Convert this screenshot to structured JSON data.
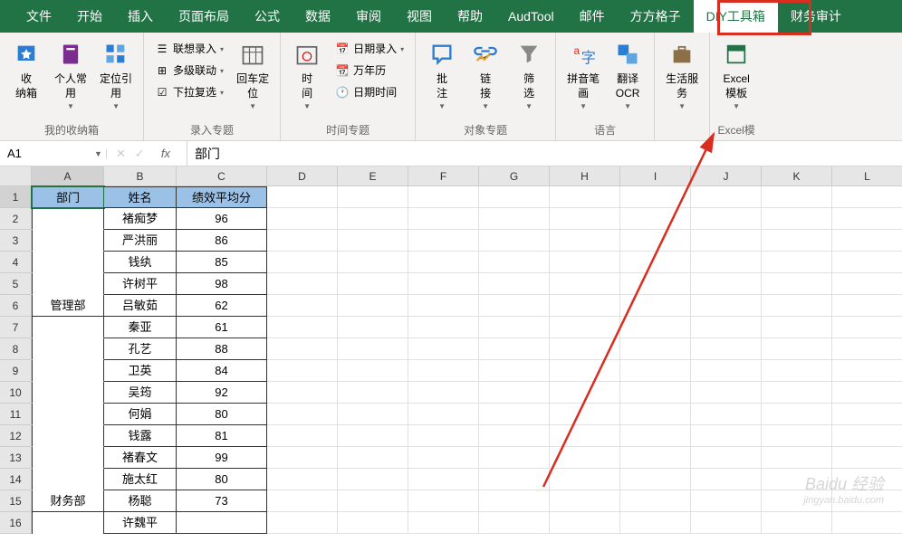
{
  "tabs": [
    "文件",
    "开始",
    "插入",
    "页面布局",
    "公式",
    "数据",
    "审阅",
    "视图",
    "帮助",
    "AudTool",
    "邮件",
    "方方格子",
    "DIY工具箱",
    "财务审计"
  ],
  "active_tab_index": 12,
  "ribbon_groups": {
    "collect": {
      "label": "我的收纳箱",
      "items": [
        {
          "label": "收\n纳箱"
        },
        {
          "label": "个人常\n用",
          "arrow": true
        },
        {
          "label": "定位引\n用",
          "arrow": true
        }
      ]
    },
    "input": {
      "label": "录入专题",
      "items": [
        {
          "label": "联想录入",
          "arrow": true
        },
        {
          "label": "多级联动",
          "arrow": true
        },
        {
          "label": "下拉复选",
          "arrow": true
        }
      ],
      "big_item": {
        "label": "回车定\n位",
        "arrow": true
      }
    },
    "time": {
      "label": "时间专题",
      "big_item": {
        "label": "时\n间",
        "arrow": true
      },
      "items": [
        {
          "label": "日期录入",
          "arrow": true
        },
        {
          "label": "万年历"
        },
        {
          "label": "日期时间"
        }
      ]
    },
    "object": {
      "label": "对象专题",
      "items": [
        {
          "label": "批\n注",
          "arrow": true
        },
        {
          "label": "链\n接",
          "arrow": true
        },
        {
          "label": "筛\n选",
          "arrow": true
        }
      ]
    },
    "lang": {
      "label": "语言",
      "items": [
        {
          "label": "拼音笔\n画",
          "arrow": true
        },
        {
          "label": "翻译\nOCR",
          "arrow": true
        }
      ]
    },
    "life": {
      "label": "",
      "items": [
        {
          "label": "生活服\n务",
          "arrow": true
        }
      ]
    },
    "excel": {
      "label": "Excel模",
      "items": [
        {
          "label": "Excel\n模板",
          "arrow": true
        }
      ]
    }
  },
  "name_box": "A1",
  "formula_value": "部门",
  "columns": [
    "A",
    "B",
    "C",
    "D",
    "E",
    "F",
    "G",
    "H",
    "I",
    "J",
    "K",
    "L"
  ],
  "sheet": {
    "headers": [
      "部门",
      "姓名",
      "绩效平均分"
    ],
    "rows": [
      {
        "dept": "",
        "name": "褚痴梦",
        "score": "96"
      },
      {
        "dept": "",
        "name": "严洪丽",
        "score": "86"
      },
      {
        "dept": "",
        "name": "钱纨",
        "score": "85"
      },
      {
        "dept": "",
        "name": "许树平",
        "score": "98"
      },
      {
        "dept": "管理部",
        "name": "吕敏茹",
        "score": "62"
      },
      {
        "dept": "",
        "name": "秦亚",
        "score": "61"
      },
      {
        "dept": "",
        "name": "孔艺",
        "score": "88"
      },
      {
        "dept": "",
        "name": "卫英",
        "score": "84"
      },
      {
        "dept": "",
        "name": "吴筠",
        "score": "92"
      },
      {
        "dept": "",
        "name": "何娟",
        "score": "80"
      },
      {
        "dept": "",
        "name": "钱露",
        "score": "81"
      },
      {
        "dept": "",
        "name": "褚春文",
        "score": "99"
      },
      {
        "dept": "",
        "name": "施太红",
        "score": "80"
      },
      {
        "dept": "财务部",
        "name": "杨聪",
        "score": "73"
      },
      {
        "dept": "",
        "name": "许魏平",
        "score": ""
      }
    ]
  },
  "watermark": {
    "main": "Baidu 经验",
    "sub": "jingyan.baidu.com"
  }
}
